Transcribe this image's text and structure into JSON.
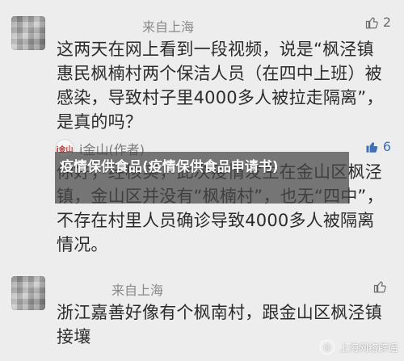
{
  "comments": [
    {
      "location": "来自上海",
      "likes": "2",
      "text": "这两天在网上看到一段视频，说是“枫泾镇惠民枫楠村两个保洁人员（在四中上班）被感染，导致村子里4000多人被拉走隔离”，是真的吗？"
    },
    {
      "author_name": "i金山(作者)",
      "author_avatar_text": "i金山",
      "likes": "6",
      "text": "你好，经核实，此次疫情发生在金山区枫泾镇，金山区并没有“枫楠村”，也无“四中”，不存在村里人员确诊导致4000多人被隔离情况。"
    },
    {
      "location": "来自上海",
      "likes": "",
      "text": "浙江嘉善好像有个枫南村，跟金山区枫泾镇接壤"
    }
  ],
  "overlay_title": "疫情保供食品(疫情保供食品申请书)",
  "watermark": "上海网络辟谣"
}
